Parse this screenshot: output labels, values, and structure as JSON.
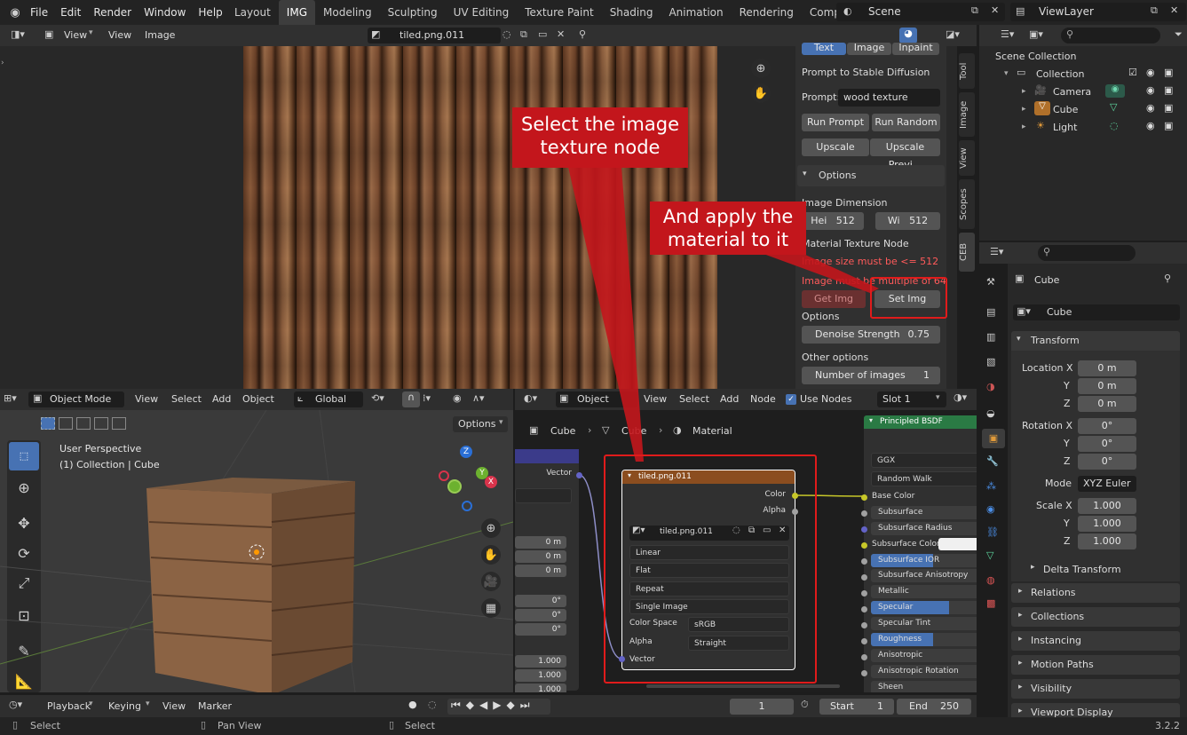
{
  "topbar": {
    "menu": [
      "File",
      "Edit",
      "Render",
      "Window",
      "Help"
    ],
    "workspaces": [
      "Layout",
      "IMG",
      "Modeling",
      "Sculpting",
      "UV Editing",
      "Texture Paint",
      "Shading",
      "Animation",
      "Rendering",
      "Compositing"
    ],
    "scene": "Scene",
    "view_layer": "ViewLayer"
  },
  "image_editor": {
    "menu": [
      "View",
      "View",
      "Image"
    ],
    "image_name": "tiled.png.011"
  },
  "sd_panel": {
    "tabs": [
      "Text",
      "Image",
      "Inpaint"
    ],
    "title": "Prompt to Stable Diffusion",
    "prompt_label": "Prompt:",
    "prompt_value": "wood texture",
    "run_prompt": "Run Prompt",
    "run_random": "Run Random",
    "upscale": "Upscale",
    "upscale_preview": "Upscale Previ...",
    "options_header": "Options",
    "image_dimension": "Image Dimension",
    "height_label": "Hei",
    "height_value": "512",
    "width_label": "Wi",
    "width_value": "512",
    "material_node": "Material Texture Node",
    "err1": "Image size must be <= 512",
    "err2": "Image must be multiple of 64",
    "get_img": "Get Img",
    "set_img": "Set Img",
    "options2": "Options",
    "denoise_label": "Denoise Strength",
    "denoise_value": "0.75",
    "other_options": "Other options",
    "num_images_label": "Number of images",
    "num_images_value": "1"
  },
  "side_tabs": [
    "Tool",
    "Image",
    "View",
    "Scopes",
    "CEB"
  ],
  "callouts": {
    "c1": "Select the image texture node",
    "c2": "And apply the material to it"
  },
  "outliner": {
    "root": "Scene Collection",
    "items": [
      {
        "name": "Collection"
      },
      {
        "name": "Camera"
      },
      {
        "name": "Cube"
      },
      {
        "name": "Light"
      }
    ]
  },
  "properties": {
    "object": "Cube",
    "object_field": "Cube",
    "transform": "Transform",
    "loc_label": "Location X",
    "loc": [
      "0 m",
      "0 m",
      "0 m"
    ],
    "rot_label": "Rotation X",
    "rot": [
      "0°",
      "0°",
      "0°"
    ],
    "mode_label": "Mode",
    "mode": "XYZ Euler",
    "scale_label": "Scale X",
    "scale": [
      "1.000",
      "1.000",
      "1.000"
    ],
    "axis": [
      "Y",
      "Z"
    ],
    "delta": "Delta Transform",
    "sections": [
      "Relations",
      "Collections",
      "Instancing",
      "Motion Paths",
      "Visibility",
      "Viewport Display"
    ]
  },
  "viewport": {
    "mode": "Object Mode",
    "menu": [
      "View",
      "Select",
      "Add",
      "Object"
    ],
    "orient": "Global",
    "options": "Options",
    "info1": "User Perspective",
    "info2": "(1) Collection | Cube"
  },
  "node_editor": {
    "type": "Object",
    "menu": [
      "View",
      "Select",
      "Add",
      "Node"
    ],
    "use_nodes": "Use Nodes",
    "slot": "Slot 1",
    "breadcrumb": [
      "Cube",
      "Cube",
      "Material"
    ],
    "left_vals": [
      "0 m",
      "0 m",
      "0 m",
      "0°",
      "0°",
      "0°",
      "1.000",
      "1.000",
      "1.000"
    ],
    "left_vector": "Vector",
    "tex_node": {
      "title": "tiled.png.011",
      "out_color": "Color",
      "out_alpha": "Alpha",
      "image": "tiled.png.011",
      "dropdowns": [
        "Linear",
        "Flat",
        "Repeat",
        "Single Image"
      ],
      "colorspace_label": "Color Space",
      "colorspace": "sRGB",
      "alpha_label": "Alpha",
      "alpha": "Straight",
      "vector": "Vector"
    },
    "bsdf": {
      "title": "Principled BSDF",
      "dist": "GGX",
      "sss": "Random Walk",
      "rows": [
        "Base Color",
        "Subsurface",
        "Subsurface Radius",
        "Subsurface Color",
        "Subsurface IOR",
        "Subsurface Anisotropy",
        "Metallic",
        "Specular",
        "Specular Tint",
        "Roughness",
        "Anisotropic",
        "Anisotropic Rotation",
        "Sheen"
      ]
    }
  },
  "timeline": {
    "menu": [
      "Playback",
      "Keying",
      "View",
      "Marker"
    ],
    "frame": "1",
    "start_label": "Start",
    "start": "1",
    "end_label": "End",
    "end": "250"
  },
  "statusbar": {
    "select": "Select",
    "pan": "Pan View",
    "select2": "Select",
    "version": "3.2.2"
  }
}
